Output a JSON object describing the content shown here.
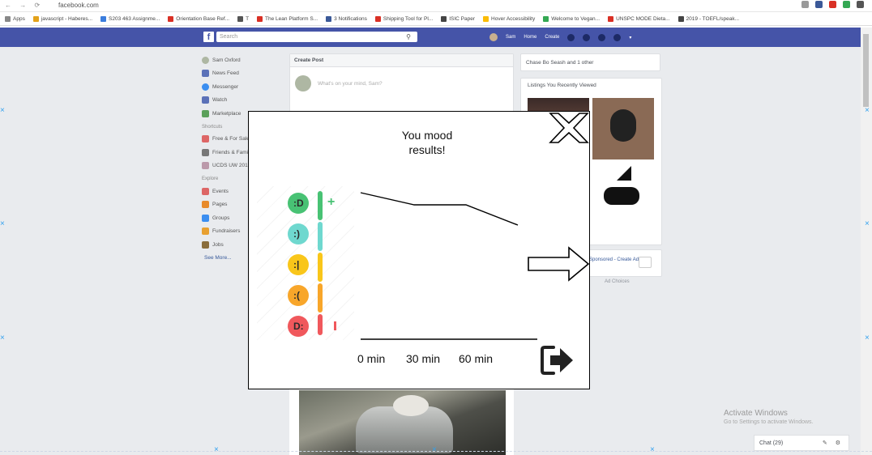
{
  "browser": {
    "url": "facebook.com",
    "bookmarks": [
      "Apps",
      "javascript - Haberes...",
      "S203 463 Assignme...",
      "Orientation Base Ref...",
      "T",
      "The Lean Platform S...",
      "3 Notifications",
      "Shipping Tool for Pl...",
      "ISIC Paper",
      "Hover Accessibility",
      "Welcome to Vegan...",
      "UNSPC MODE Dieta...",
      "2019 - TOEFL/speak..."
    ],
    "bookmark_colors": [
      "#888888",
      "#e3a21a",
      "#3b7ddd",
      "#d93025",
      "#555555",
      "#d93025",
      "#3b5998",
      "#d93025",
      "#444444",
      "#fbbc05",
      "#34a853",
      "#d93025",
      "#444444",
      "#1a73e8",
      "#34a853"
    ]
  },
  "facebook": {
    "logo": "f",
    "search_placeholder": "Search",
    "nav": [
      "Sam",
      "Home",
      "Create"
    ],
    "left_col": {
      "profile": "Sam Oxford",
      "items": [
        "News Feed",
        "Messenger",
        "Watch",
        "Marketplace"
      ],
      "shortcuts_label": "Shortcuts",
      "shortcuts": [
        "Free & For Sale",
        "Friends & Family",
        "UCDS UW 2019"
      ],
      "explore_label": "Explore",
      "explore": [
        "Events",
        "Pages",
        "Groups",
        "Fundraisers",
        "Jobs"
      ],
      "see_more": "See More..."
    },
    "create_post": {
      "header": "Create Post",
      "placeholder": "What's on your mind, Sam?"
    },
    "right_col": {
      "story": "Chase Bo Seash and 1 other",
      "marketplace_header": "Listings You Recently Viewed",
      "sponsored_links": "Sponsored - Create Ad",
      "ad_choices": "Ad Choices"
    }
  },
  "windows_notice": {
    "title": "Activate Windows",
    "subtitle": "Go to Settings to activate Windows."
  },
  "chat": {
    "label": "Chat (29)"
  },
  "modal": {
    "title_line1": "You mood",
    "title_line2": "results!",
    "plus": "+",
    "x_ticks": [
      "0 min",
      "30 min",
      "60 min"
    ],
    "close_icon": "close-x-icon",
    "next_icon": "right-arrow-icon",
    "exit_icon": "exit-icon",
    "mood_levels": [
      {
        "name": "very-happy",
        "color": "#48c274"
      },
      {
        "name": "happy",
        "color": "#6fd8cf"
      },
      {
        "name": "neutral",
        "color": "#f9c61a"
      },
      {
        "name": "sad",
        "color": "#f8a62a"
      },
      {
        "name": "very-sad",
        "color": "#f0585c"
      }
    ]
  }
}
